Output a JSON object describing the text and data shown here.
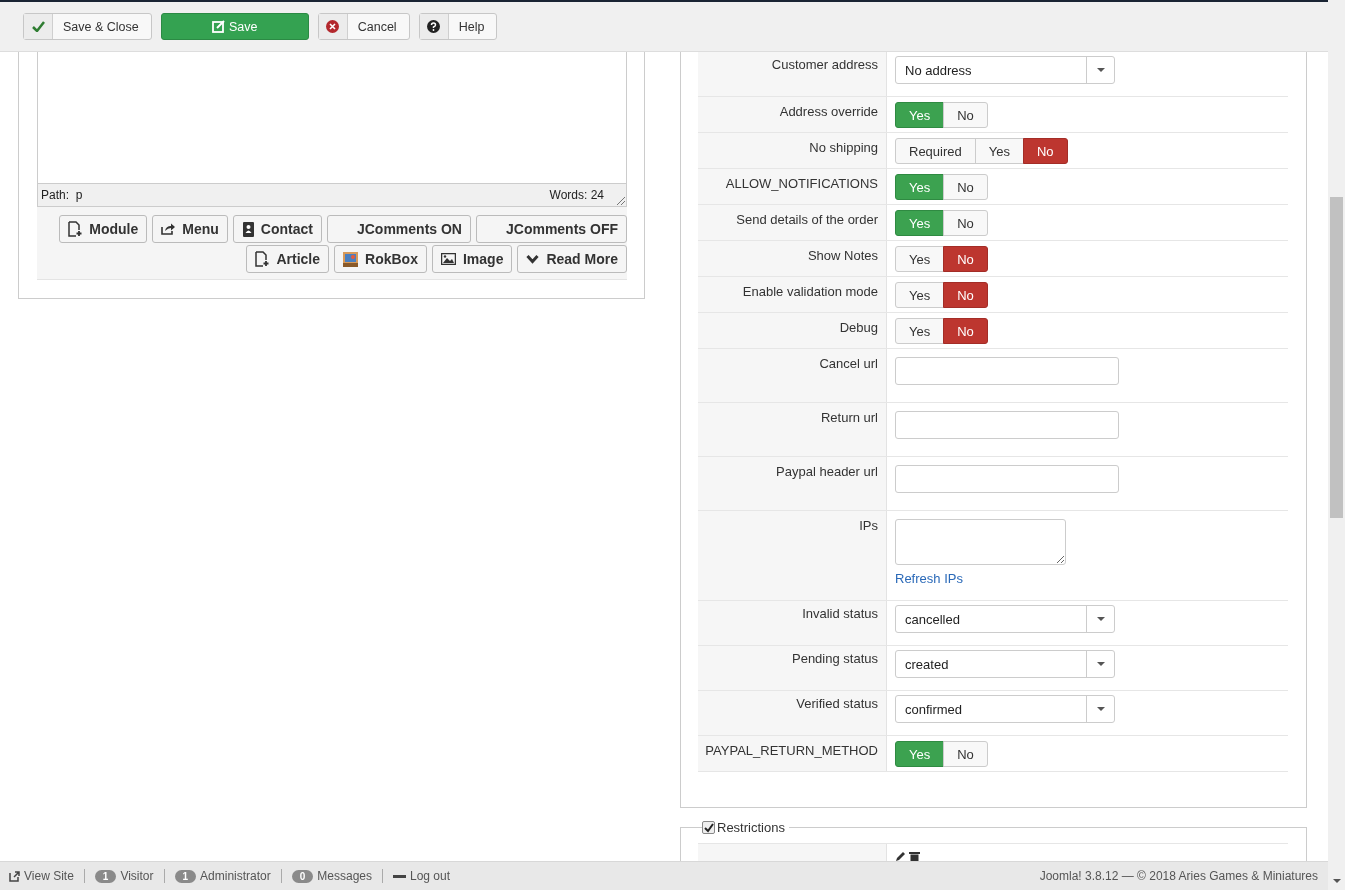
{
  "toolbar": [
    {
      "label": "Save & Close",
      "kind": "save-close"
    },
    {
      "label": "Save",
      "kind": "save"
    },
    {
      "label": "Cancel",
      "kind": "cancel"
    },
    {
      "label": "Help",
      "kind": "help"
    }
  ],
  "editor": {
    "path_label": "Path:",
    "path": "p",
    "words": "Words: 24",
    "buttons": [
      {
        "label": "Module",
        "kind": "file"
      },
      {
        "label": "Menu",
        "kind": "share"
      },
      {
        "label": "Contact",
        "kind": "book"
      },
      {
        "label": "JComments ON",
        "kind": "none"
      },
      {
        "label": "JComments OFF",
        "kind": "none"
      },
      {
        "label": "Article",
        "kind": "file"
      },
      {
        "label": "RokBox",
        "kind": "photo"
      },
      {
        "label": "Image",
        "kind": "image"
      },
      {
        "label": "Read More",
        "kind": "chevron"
      }
    ]
  },
  "settings": {
    "rows": [
      {
        "label": "Customer address",
        "kind": "select",
        "value": "No address"
      },
      {
        "label": "Address override",
        "kind": "toggle",
        "options": [
          {
            "label": "Yes",
            "kind": "yes",
            "selected": true
          },
          {
            "label": "No",
            "kind": "no",
            "selected": false
          }
        ]
      },
      {
        "label": "No shipping",
        "kind": "toggle",
        "options": [
          {
            "label": "Required",
            "kind": "neutral",
            "selected": false
          },
          {
            "label": "Yes",
            "kind": "yes",
            "selected": false
          },
          {
            "label": "No",
            "kind": "no",
            "selected": true
          }
        ]
      },
      {
        "label": "ALLOW_NOTIFICATIONS",
        "kind": "toggle",
        "options": [
          {
            "label": "Yes",
            "kind": "yes",
            "selected": true
          },
          {
            "label": "No",
            "kind": "no",
            "selected": false
          }
        ]
      },
      {
        "label": "Send details of the order",
        "kind": "toggle",
        "options": [
          {
            "label": "Yes",
            "kind": "yes",
            "selected": true
          },
          {
            "label": "No",
            "kind": "no",
            "selected": false
          }
        ]
      },
      {
        "label": "Show Notes",
        "kind": "toggle",
        "options": [
          {
            "label": "Yes",
            "kind": "yes",
            "selected": false
          },
          {
            "label": "No",
            "kind": "no",
            "selected": true
          }
        ]
      },
      {
        "label": "Enable validation mode",
        "kind": "toggle",
        "options": [
          {
            "label": "Yes",
            "kind": "yes",
            "selected": false
          },
          {
            "label": "No",
            "kind": "no",
            "selected": true
          }
        ]
      },
      {
        "label": "Debug",
        "kind": "toggle",
        "options": [
          {
            "label": "Yes",
            "kind": "yes",
            "selected": false
          },
          {
            "label": "No",
            "kind": "no",
            "selected": true
          }
        ]
      },
      {
        "label": "Cancel url",
        "kind": "text"
      },
      {
        "label": "Return url",
        "kind": "text"
      },
      {
        "label": "Paypal header url",
        "kind": "text"
      },
      {
        "label": "IPs",
        "kind": "textarea",
        "link": "Refresh IPs"
      },
      {
        "label": "Invalid status",
        "kind": "select",
        "value": "cancelled"
      },
      {
        "label": "Pending status",
        "kind": "select",
        "value": "created"
      },
      {
        "label": "Verified status",
        "kind": "select",
        "value": "confirmed"
      },
      {
        "label": "PAYPAL_RETURN_METHOD",
        "kind": "toggle",
        "options": [
          {
            "label": "Yes",
            "kind": "yes",
            "selected": true
          },
          {
            "label": "No",
            "kind": "no",
            "selected": false
          }
        ]
      }
    ]
  },
  "restrictions": {
    "legend": "Restrictions",
    "checked": true
  },
  "status_bar": {
    "items": [
      {
        "kind": "link",
        "label": "View Site"
      },
      {
        "kind": "count",
        "count": "1",
        "label": "Visitor"
      },
      {
        "kind": "count",
        "count": "1",
        "label": "Administrator"
      },
      {
        "kind": "count",
        "count": "0",
        "label": "Messages"
      },
      {
        "kind": "logout",
        "label": "Log out"
      }
    ],
    "copyright": "Joomla! 3.8.12  —  © 2018 Aries Games & Miniatures"
  }
}
